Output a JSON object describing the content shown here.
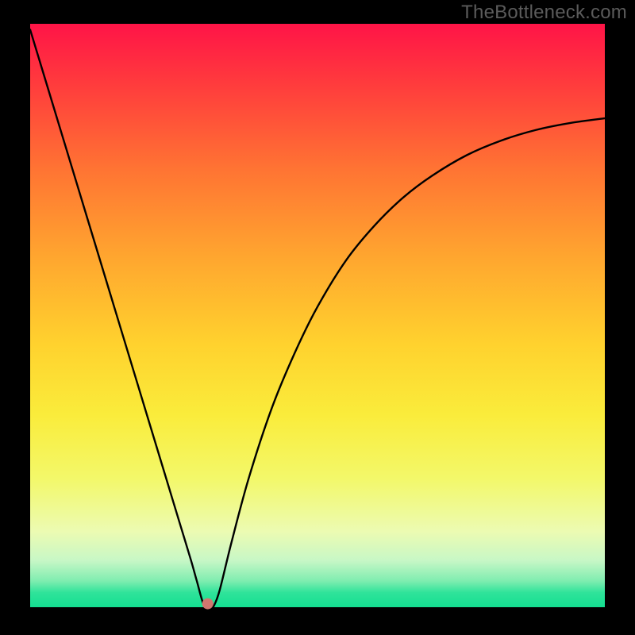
{
  "watermark": "TheBottleneck.com",
  "chart_data": {
    "type": "line",
    "title": "",
    "xlabel": "",
    "ylabel": "",
    "xlim": [
      0,
      100
    ],
    "ylim": [
      0,
      100
    ],
    "grid": false,
    "legend": false,
    "annotations": [],
    "background_gradient_stops": [
      {
        "offset": 0.0,
        "color": "#ff1447"
      },
      {
        "offset": 0.1,
        "color": "#ff3a3d"
      },
      {
        "offset": 0.25,
        "color": "#ff7433"
      },
      {
        "offset": 0.4,
        "color": "#ffa62f"
      },
      {
        "offset": 0.55,
        "color": "#ffd22e"
      },
      {
        "offset": 0.67,
        "color": "#faec3b"
      },
      {
        "offset": 0.78,
        "color": "#f3f86a"
      },
      {
        "offset": 0.87,
        "color": "#ecfbb2"
      },
      {
        "offset": 0.92,
        "color": "#c7f7c6"
      },
      {
        "offset": 0.955,
        "color": "#7fedb0"
      },
      {
        "offset": 0.975,
        "color": "#2fe39a"
      },
      {
        "offset": 1.0,
        "color": "#14df91"
      }
    ],
    "series": [
      {
        "name": "bottleneck-curve",
        "x": [
          0.0,
          2.0,
          4.0,
          6.0,
          8.0,
          10.0,
          12.0,
          14.0,
          16.0,
          18.0,
          20.0,
          22.0,
          24.0,
          26.0,
          28.0,
          29.0,
          30.3,
          31.5,
          32.0,
          33.0,
          35.0,
          38.0,
          42.0,
          46.0,
          50.0,
          55.0,
          60.0,
          65.0,
          70.0,
          76.0,
          82.0,
          88.0,
          94.0,
          100.0
        ],
        "y": [
          99.0,
          92.5,
          86.0,
          79.5,
          73.0,
          66.5,
          60.0,
          53.5,
          47.0,
          40.5,
          34.0,
          27.5,
          21.0,
          14.5,
          8.0,
          4.5,
          0.2,
          0.2,
          0.3,
          3.0,
          11.0,
          22.0,
          34.0,
          43.5,
          51.5,
          59.5,
          65.5,
          70.3,
          74.0,
          77.5,
          80.0,
          81.8,
          83.0,
          83.8
        ]
      }
    ],
    "marker": {
      "x": 30.9,
      "y": 0.6,
      "color": "#d1766f",
      "radius_px": 7
    }
  }
}
